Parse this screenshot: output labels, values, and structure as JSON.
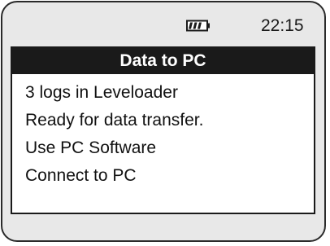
{
  "status": {
    "icon": "battery-icon",
    "battery_level": 0.75,
    "time": "22:15"
  },
  "screen": {
    "title": "Data to PC",
    "lines": [
      "3 logs in Leveloader",
      "Ready for data transfer.",
      "Use PC Software",
      "Connect to PC"
    ]
  },
  "colors": {
    "bezel": "#e8e8e8",
    "title_bar": "#1a1a1a",
    "panel": "#ffffff"
  }
}
